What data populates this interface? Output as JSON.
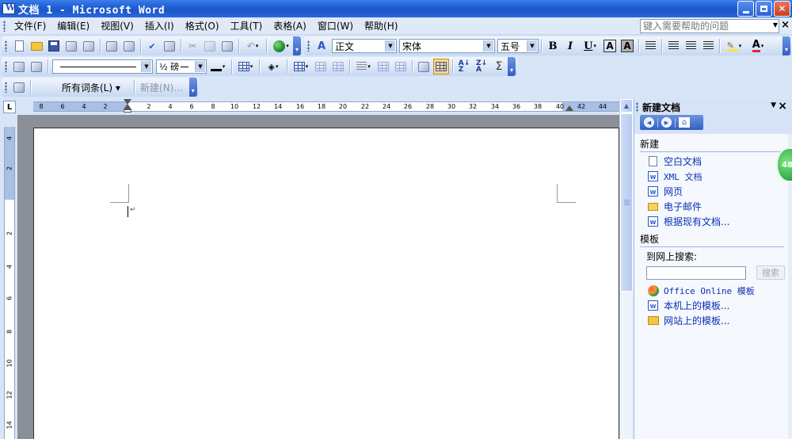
{
  "window": {
    "title": "文档 1 - Microsoft Word"
  },
  "menubar": {
    "items": [
      {
        "label": "文件(F)"
      },
      {
        "label": "编辑(E)"
      },
      {
        "label": "视图(V)"
      },
      {
        "label": "插入(I)"
      },
      {
        "label": "格式(O)"
      },
      {
        "label": "工具(T)"
      },
      {
        "label": "表格(A)"
      },
      {
        "label": "窗口(W)"
      },
      {
        "label": "帮助(H)"
      }
    ],
    "help_placeholder": "键入需要帮助的问题"
  },
  "formatting": {
    "style_value": "正文",
    "font_value": "宋体",
    "size_value": "五号",
    "bold_label": "B",
    "italic_label": "I",
    "underline_label": "U",
    "char_border_label": "A",
    "char_shading_label": "A",
    "font_color_label": "A"
  },
  "tables_borders": {
    "line_weight_value": "½ 磅"
  },
  "reviewing": {
    "markup_label": "所有词条(L) ▾",
    "new_comment_label": "新建(N)..."
  },
  "ruler": {
    "tab_selector": "L",
    "horizontal_labels": [
      "8",
      "6",
      "4",
      "2",
      "2",
      "4",
      "6",
      "8",
      "10",
      "12",
      "14",
      "16",
      "18",
      "20",
      "22",
      "24",
      "26",
      "28",
      "30",
      "32",
      "34",
      "36",
      "38",
      "40",
      "42",
      "44"
    ],
    "vertical_labels": [
      "4",
      "2",
      "2",
      "4",
      "6",
      "8",
      "10",
      "12",
      "14"
    ]
  },
  "taskpane": {
    "title": "新建文档",
    "section_new": "新建",
    "new_links": [
      {
        "label": "空白文档",
        "icon": "blank-doc-icon"
      },
      {
        "label": "XML 文档",
        "icon": "xml-doc-icon"
      },
      {
        "label": "网页",
        "icon": "web-page-icon"
      },
      {
        "label": "电子邮件",
        "icon": "email-icon"
      },
      {
        "label": "根据现有文档...",
        "icon": "existing-doc-icon"
      }
    ],
    "section_templates": "模板",
    "search_online_label": "到网上搜索:",
    "search_button": "搜索",
    "template_links": [
      {
        "label": "Office Online 模板",
        "icon": "office-online-icon"
      },
      {
        "label": "本机上的模板...",
        "icon": "local-template-icon"
      },
      {
        "label": "网站上的模板...",
        "icon": "website-template-icon"
      }
    ]
  },
  "badge": {
    "value": "48"
  }
}
